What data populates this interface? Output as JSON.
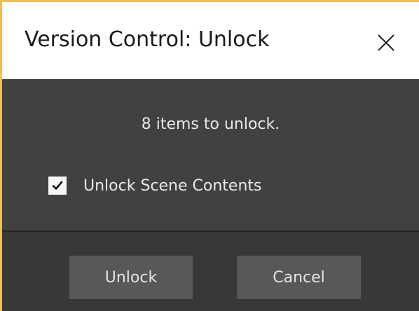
{
  "dialog": {
    "title": "Version Control: Unlock",
    "close_icon": "close-icon",
    "message": "8 items to unlock.",
    "checkbox": {
      "label": "Unlock Scene Contents",
      "checked": true
    },
    "buttons": {
      "unlock_label": "Unlock",
      "cancel_label": "Cancel"
    }
  },
  "colors": {
    "accent_border": "#f2c04b",
    "body_bg": "#414141",
    "footer_bg": "#383838",
    "button_bg": "#585858",
    "text": "#e8e8e8"
  }
}
